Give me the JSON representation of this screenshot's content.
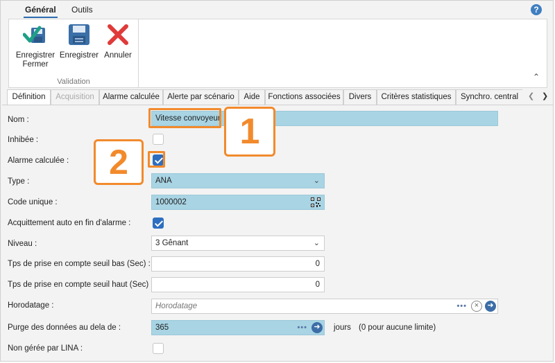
{
  "ribbon": {
    "tabs": [
      "Général",
      "Outils"
    ],
    "help": "?",
    "buttons": {
      "save_close": "Enregistrer\nFermer",
      "save": "Enregistrer",
      "cancel": "Annuler"
    },
    "group": "Validation"
  },
  "tabs": [
    "Définition",
    "Acquisition",
    "Alarme calculée",
    "Alerte par scénario",
    "Aide",
    "Fonctions associées",
    "Divers",
    "Critères statistiques",
    "Synchro. central"
  ],
  "form": {
    "nom_label": "Nom :",
    "nom_value": "Vitesse convoyeur",
    "inhibee_label": "Inhibée :",
    "inhibee_checked": false,
    "alarme_label": "Alarme calculée :",
    "alarme_checked": true,
    "type_label": "Type :",
    "type_value": "ANA",
    "code_label": "Code unique :",
    "code_value": "1000002",
    "acquit_label": "Acquittement auto en fin d'alarme :",
    "acquit_checked": true,
    "niveau_label": "Niveau :",
    "niveau_value": "3 Gênant",
    "tps_bas_label": "Tps de prise en compte seuil bas (Sec) :",
    "tps_bas_value": "0",
    "tps_haut_label": "Tps de prise en compte seuil haut (Sec) :",
    "tps_haut_value": "0",
    "horo_label": "Horodatage :",
    "horo_placeholder": "Horodatage",
    "purge_label": "Purge des données au dela de :",
    "purge_value": "365",
    "purge_unit": "jours",
    "purge_note": "(0 pour aucune limite)",
    "lina_label": "Non gérée par LINA :",
    "lina_checked": false
  },
  "callouts": [
    "1",
    "2"
  ],
  "colors": {
    "accent": "#2d6ec0",
    "callout": "#f28a2c",
    "field_blue": "#a8d4e4"
  }
}
